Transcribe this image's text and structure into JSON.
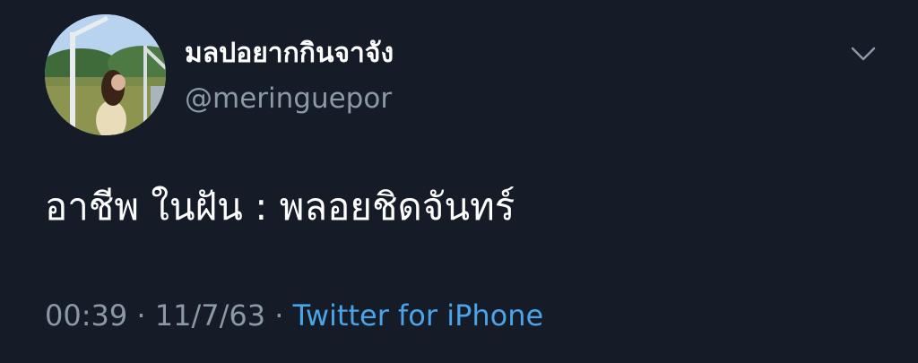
{
  "tweet": {
    "author": {
      "display_name": "มลปอยากกินจาจัง",
      "handle": "@meringuepor",
      "avatar_icon": "profile-photo-avatar"
    },
    "menu_icon": "chevron-down-icon",
    "text": "อาชีพ ในฝัน : พลอยชิดจันทร์",
    "meta": {
      "time": "00:39",
      "separator": "·",
      "date": "11/7/63",
      "source": "Twitter for iPhone"
    }
  },
  "colors": {
    "background": "#151c28",
    "primary_text": "#ffffff",
    "secondary_text": "#8b98a6",
    "link": "#4ba3e8"
  }
}
